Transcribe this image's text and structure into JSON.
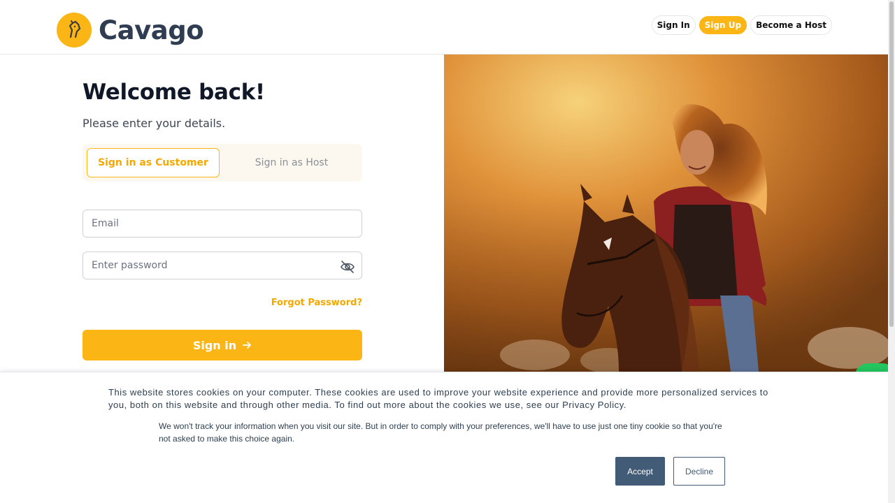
{
  "header": {
    "brand": "Cavago",
    "nav": {
      "sign_in": "Sign In",
      "sign_up": "Sign Up",
      "become_host": "Become a Host"
    }
  },
  "form": {
    "title": "Welcome back!",
    "subtitle": "Please enter your details.",
    "tabs": {
      "customer": "Sign in as Customer",
      "host": "Sign in as Host",
      "active": "customer"
    },
    "email": {
      "placeholder": "Email",
      "value": ""
    },
    "password": {
      "placeholder": "Enter password",
      "value": ""
    },
    "forgot_link": "Forgot Password?",
    "submit_label": "Sign in"
  },
  "cookie_banner": {
    "main_text": "This website stores cookies on your computer. These cookies are used to improve your website experience and provide more personalized services to you, both on this website and through other media. To find out more about the cookies we use, see our Privacy Policy.",
    "sub_text": "We won't track your information when you visit our site. But in order to comply with your preferences, we'll have to use just one tiny cookie so that you're not asked to make this choice again.",
    "accept_label": "Accept",
    "decline_label": "Decline"
  },
  "colors": {
    "accent": "#fbb515",
    "brand_text": "#2e3d52",
    "cookie_button": "#425b76"
  },
  "icons": {
    "logo": "horse-head-icon",
    "password_toggle": "eye-off-icon",
    "submit_arrow": "arrow-right-icon"
  }
}
